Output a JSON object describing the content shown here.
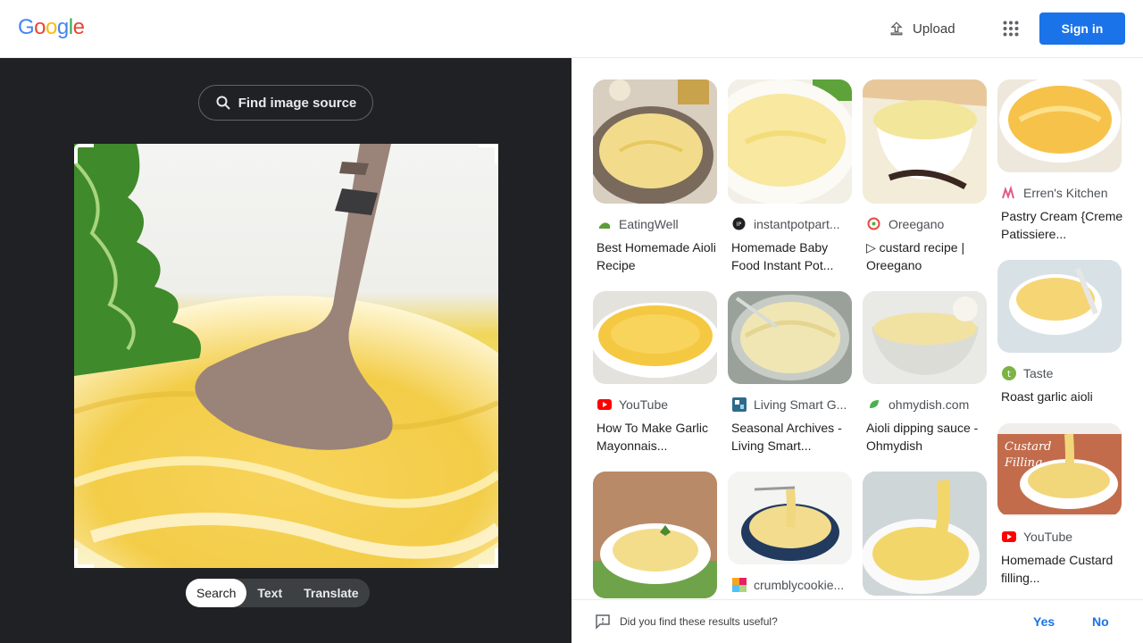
{
  "header": {
    "logo_letters": [
      "G",
      "o",
      "o",
      "g",
      "l",
      "e"
    ],
    "logo_colors": [
      "#4285f4",
      "#ea4335",
      "#fbbc05",
      "#4285f4",
      "#34a853",
      "#ea4335"
    ],
    "upload_label": "Upload",
    "signin_label": "Sign in"
  },
  "left": {
    "find_source_label": "Find image source",
    "tabs": [
      "Search",
      "Text",
      "Translate"
    ],
    "active_tab": "Search"
  },
  "results": [
    {
      "source": "EatingWell",
      "title": "Best Homemade Aioli Recipe",
      "favicon": "eatingwell-icon",
      "fav_color": "#5a9e3a"
    },
    {
      "source": "instantpotpart...",
      "title": "Homemade Baby Food Instant Pot...",
      "favicon": "instantpot-icon",
      "fav_color": "#202124"
    },
    {
      "source": "Oreegano",
      "title": "▷ custard recipe | Oreegano",
      "favicon": "oreegano-icon",
      "fav_color": "#e84b3c"
    },
    {
      "source": "Erren's Kitchen",
      "title": "Pastry Cream {Creme Patissiere...",
      "favicon": "errens-kitchen-icon",
      "fav_color": "#e05a8a"
    },
    {
      "source": "YouTube",
      "title": "How To Make Garlic Mayonnais...",
      "favicon": "youtube-icon",
      "fav_color": "#ff0000"
    },
    {
      "source": "Living Smart G...",
      "title": "Seasonal Archives - Living Smart...",
      "favicon": "living-smart-icon",
      "fav_color": "#2e6b8a"
    },
    {
      "source": "ohmydish.com",
      "title": "Aioli dipping sauce - Ohmydish",
      "favicon": "ohmydish-icon",
      "fav_color": "#4caf50"
    },
    {
      "source": "Taste",
      "title": "Roast garlic aioli",
      "favicon": "taste-icon",
      "fav_color": "#7cb342"
    },
    {
      "source": "crumblycookie...",
      "title": "",
      "favicon": "crumbly-cookie-icon",
      "fav_color": "#f5a623"
    },
    {
      "source": "YouTube",
      "title": "Homemade Custard filling...",
      "favicon": "youtube-icon",
      "fav_color": "#ff0000"
    }
  ],
  "feedback": {
    "question": "Did you find these results useful?",
    "yes_label": "Yes",
    "no_label": "No"
  }
}
